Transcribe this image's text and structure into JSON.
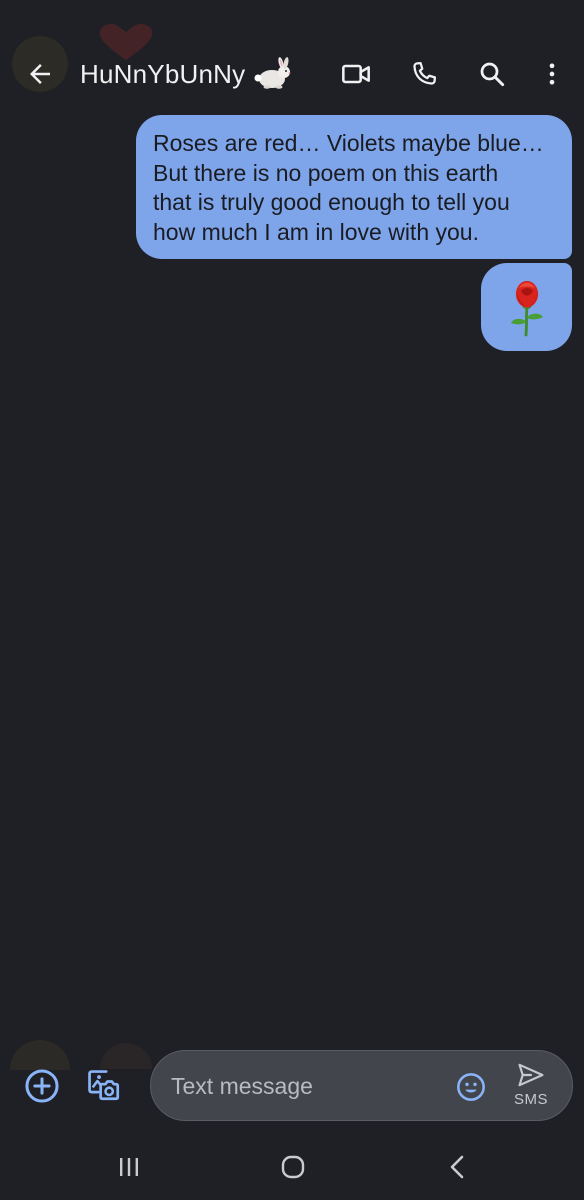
{
  "header": {
    "contact_name": "HuNnYbUnNy",
    "icons": [
      "back-arrow-icon",
      "rabbit-icon",
      "video-call-icon",
      "phone-icon",
      "search-icon",
      "more-vert-icon"
    ]
  },
  "messages": [
    {
      "sender": "me",
      "type": "text",
      "text": "Roses are red… Violets maybe blue…\nBut there is no poem on this earth\nthat is truly good enough to tell you\nhow much I am in love with you."
    },
    {
      "sender": "me",
      "type": "emoji",
      "icon": "rose-icon"
    }
  ],
  "composer": {
    "placeholder": "Text message",
    "send_label": "SMS",
    "icons": [
      "add-circle-icon",
      "gallery-camera-icon",
      "emoji-icon",
      "send-icon"
    ]
  },
  "navbar": {
    "icons": [
      "recents-icon",
      "home-icon",
      "back-chevron-icon"
    ]
  },
  "colors": {
    "background": "#1f2025",
    "bubble": "#7ea4e9",
    "accent": "#8ab4f8",
    "composer_bg": "#43454c"
  }
}
